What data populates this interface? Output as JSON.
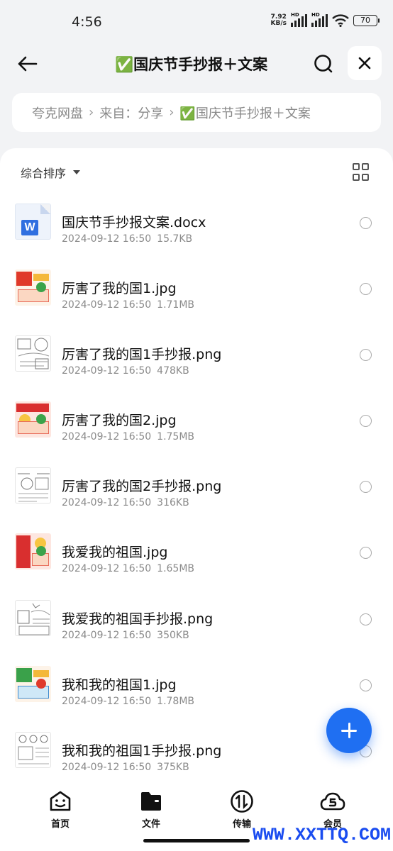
{
  "status_bar": {
    "time": "4:56",
    "net_speed_value": "7.92",
    "net_speed_unit": "KB/s",
    "sim1_tag": "HD",
    "sim2_tag": "HD",
    "battery": "70"
  },
  "header": {
    "title": "✅国庆节手抄报＋文案",
    "back_icon": "arrow-left-icon",
    "search_icon": "search-icon",
    "close_icon": "close-icon"
  },
  "breadcrumb": {
    "items": [
      "夸克网盘",
      "来自：分享",
      "✅国庆节手抄报＋文案"
    ],
    "separator": "›"
  },
  "sort": {
    "label": "综合排序",
    "view_icon": "grid-view-icon"
  },
  "files": [
    {
      "name": "国庆节手抄报文案.docx",
      "date": "2024-09-12 16:50",
      "size": "15.7KB",
      "thumb": "word-doc-icon"
    },
    {
      "name": "厉害了我的国1.jpg",
      "date": "2024-09-12 16:50",
      "size": "1.71MB",
      "thumb": "image-thumbnail"
    },
    {
      "name": "厉害了我的国1手抄报.png",
      "date": "2024-09-12 16:50",
      "size": "478KB",
      "thumb": "sketch-thumbnail"
    },
    {
      "name": "厉害了我的国2.jpg",
      "date": "2024-09-12 16:50",
      "size": "1.75MB",
      "thumb": "image-thumbnail"
    },
    {
      "name": "厉害了我的国2手抄报.png",
      "date": "2024-09-12 16:50",
      "size": "316KB",
      "thumb": "sketch-thumbnail"
    },
    {
      "name": "我爱我的祖国.jpg",
      "date": "2024-09-12 16:50",
      "size": "1.65MB",
      "thumb": "image-thumbnail"
    },
    {
      "name": "我爱我的祖国手抄报.png",
      "date": "2024-09-12 16:50",
      "size": "350KB",
      "thumb": "sketch-thumbnail"
    },
    {
      "name": "我和我的祖国1.jpg",
      "date": "2024-09-12 16:50",
      "size": "1.78MB",
      "thumb": "image-thumbnail"
    },
    {
      "name": "我和我的祖国1手抄报.png",
      "date": "2024-09-12 16:50",
      "size": "375KB",
      "thumb": "sketch-thumbnail"
    }
  ],
  "fab": {
    "icon": "plus-icon"
  },
  "bottom_nav": [
    {
      "label": "首页",
      "icon": "home-smile-icon"
    },
    {
      "label": "文件",
      "icon": "folder-icon"
    },
    {
      "label": "传输",
      "icon": "transfer-icon"
    },
    {
      "label": "会员",
      "icon": "member-cloud-icon"
    }
  ],
  "watermark": "WWW.XXTTQ.COM",
  "colors": {
    "accent": "#1f6ff2",
    "background": "#f2f3f5",
    "watermark": "#1a4cf0"
  }
}
